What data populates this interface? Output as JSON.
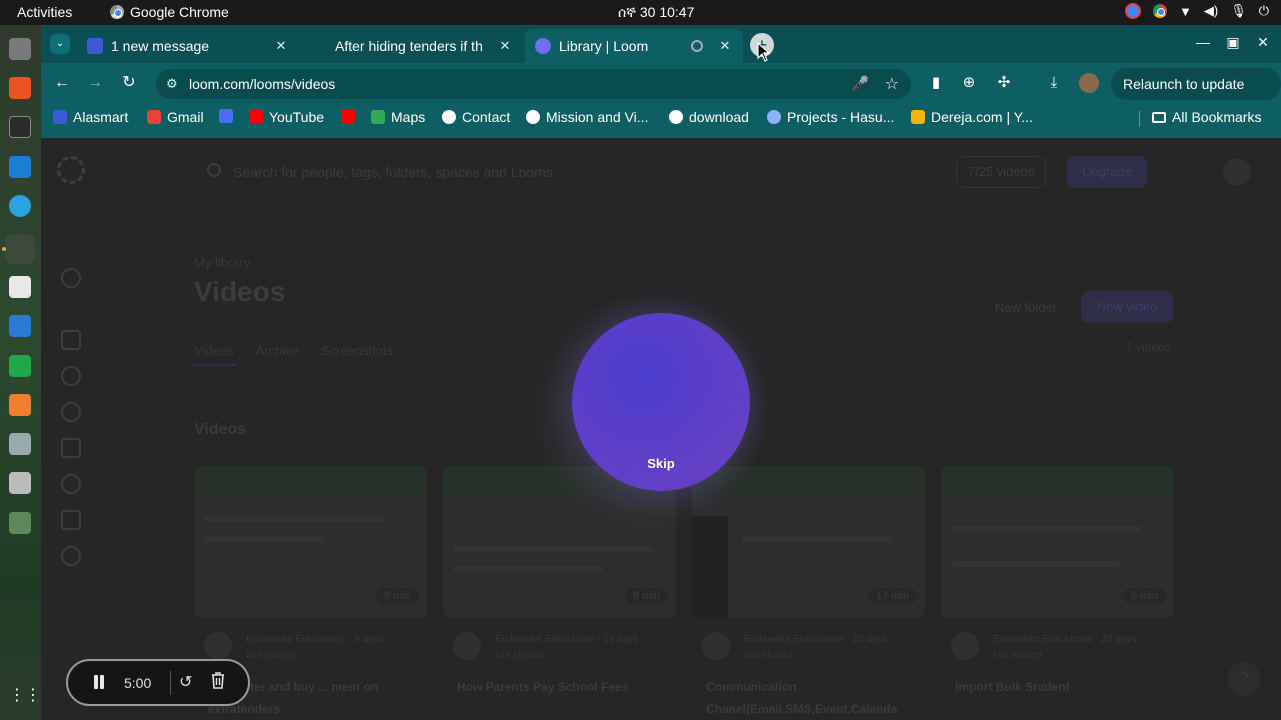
{
  "topbar": {
    "activities": "Activities",
    "app_name": "Google Chrome",
    "clock": "ሰኞ 30  10:47"
  },
  "tabs": [
    {
      "title": "1 new message",
      "close": "✕"
    },
    {
      "title": "After hiding tenders if th",
      "close": "✕"
    },
    {
      "title": "Library | Loom",
      "close": "✕"
    }
  ],
  "toolbar": {
    "url": "loom.com/looms/videos",
    "relaunch_label": "Relaunch to update"
  },
  "bookmarks": [
    {
      "label": "Alasmart",
      "color": "#3b5bd9"
    },
    {
      "label": "Gmail",
      "color": "#ea4335"
    },
    {
      "label": "",
      "color": "#4a6cf7"
    },
    {
      "label": "YouTube",
      "color": "#ff0000"
    },
    {
      "label": "",
      "color": "#ff0000"
    },
    {
      "label": "Maps",
      "color": "#34a853"
    },
    {
      "label": "Contact",
      "color": "#ffffff"
    },
    {
      "label": "Mission and Vi...",
      "color": "#ffffff"
    },
    {
      "label": "download",
      "color": "#ffffff"
    },
    {
      "label": "Projects - Hasu...",
      "color": "#8ab4f8"
    },
    {
      "label": "Dereja.com | Y...",
      "color": "#f4b400"
    }
  ],
  "all_bookmarks": "All Bookmarks",
  "page": {
    "search_placeholder": "Search for people, tags, folders, spaces and Looms",
    "videos_count": "7/25 videos",
    "upgrade": "Upgrade",
    "library_sub": "My library",
    "library_title": "Videos",
    "new_folder": "New folder",
    "new_video": "New video",
    "subtabs": [
      "Videos",
      "Archive",
      "Screenshots"
    ],
    "total": "7 videos",
    "section_title": "Videos",
    "cards": [
      {
        "duration": "9 min",
        "author": "Endaweke Enkushone",
        "age": "· 9 days",
        "shared": "Not shared",
        "title": "... register and buy ... ment on extratenders"
      },
      {
        "duration": "8 min",
        "author": "Endaweke Enkushone",
        "age": "· 19 days",
        "shared": "Not shared",
        "title": "How Parents Pay School Fees"
      },
      {
        "duration": "17 min",
        "author": "Endaweke Enkushone",
        "age": "· 20 days",
        "shared": "Not shared",
        "title": "Communication Chanel(Email,SMS,Event,Calenda"
      },
      {
        "duration": "6 min",
        "author": "Endaweke Enkushone",
        "age": "· 20 days",
        "shared": "Not shared",
        "title": "Import Bulk Student"
      }
    ],
    "help": "?"
  },
  "countdown": {
    "skip": "Skip"
  },
  "recorder": {
    "time": "5:00"
  }
}
